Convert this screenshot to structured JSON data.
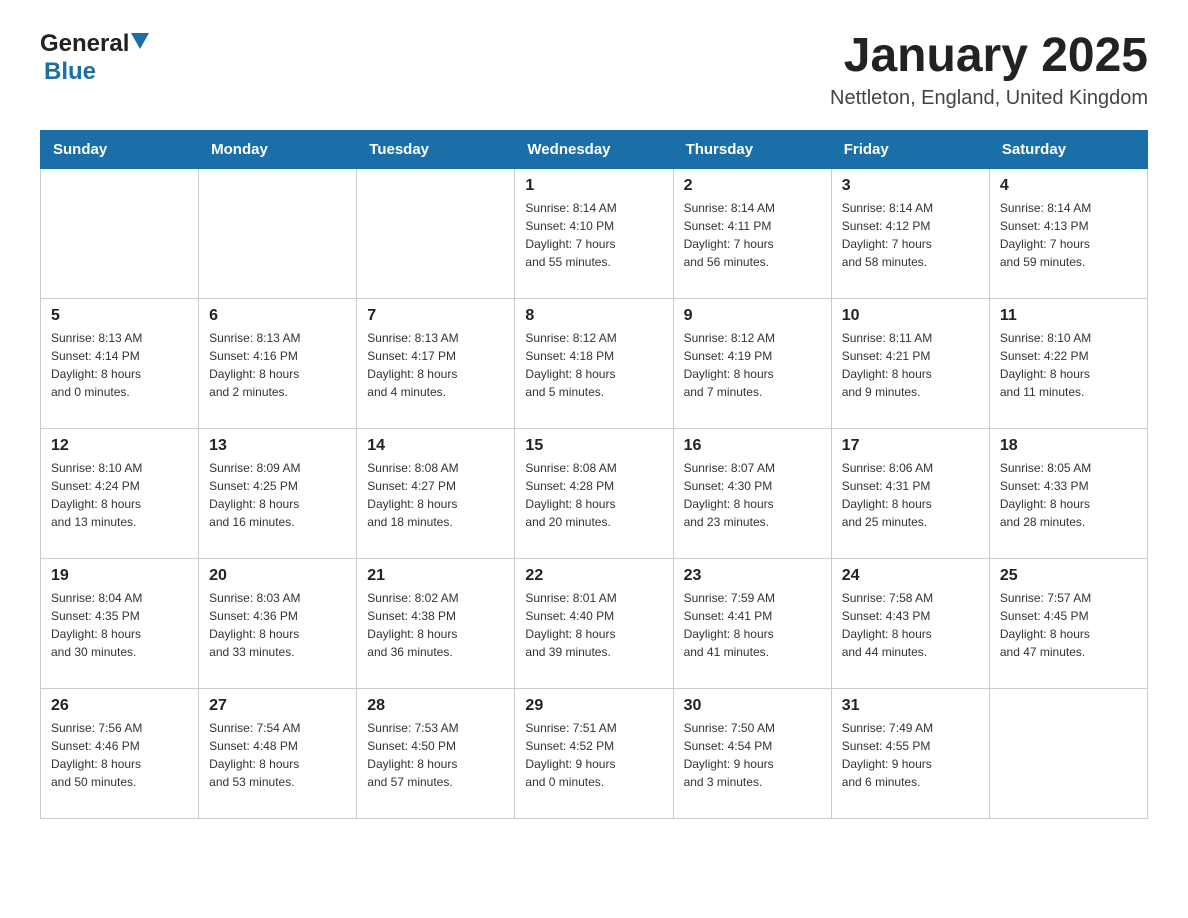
{
  "logo": {
    "text_general": "General",
    "text_blue": "Blue"
  },
  "header": {
    "title": "January 2025",
    "location": "Nettleton, England, United Kingdom"
  },
  "weekdays": [
    "Sunday",
    "Monday",
    "Tuesday",
    "Wednesday",
    "Thursday",
    "Friday",
    "Saturday"
  ],
  "weeks": [
    [
      {
        "day": "",
        "info": ""
      },
      {
        "day": "",
        "info": ""
      },
      {
        "day": "",
        "info": ""
      },
      {
        "day": "1",
        "info": "Sunrise: 8:14 AM\nSunset: 4:10 PM\nDaylight: 7 hours\nand 55 minutes."
      },
      {
        "day": "2",
        "info": "Sunrise: 8:14 AM\nSunset: 4:11 PM\nDaylight: 7 hours\nand 56 minutes."
      },
      {
        "day": "3",
        "info": "Sunrise: 8:14 AM\nSunset: 4:12 PM\nDaylight: 7 hours\nand 58 minutes."
      },
      {
        "day": "4",
        "info": "Sunrise: 8:14 AM\nSunset: 4:13 PM\nDaylight: 7 hours\nand 59 minutes."
      }
    ],
    [
      {
        "day": "5",
        "info": "Sunrise: 8:13 AM\nSunset: 4:14 PM\nDaylight: 8 hours\nand 0 minutes."
      },
      {
        "day": "6",
        "info": "Sunrise: 8:13 AM\nSunset: 4:16 PM\nDaylight: 8 hours\nand 2 minutes."
      },
      {
        "day": "7",
        "info": "Sunrise: 8:13 AM\nSunset: 4:17 PM\nDaylight: 8 hours\nand 4 minutes."
      },
      {
        "day": "8",
        "info": "Sunrise: 8:12 AM\nSunset: 4:18 PM\nDaylight: 8 hours\nand 5 minutes."
      },
      {
        "day": "9",
        "info": "Sunrise: 8:12 AM\nSunset: 4:19 PM\nDaylight: 8 hours\nand 7 minutes."
      },
      {
        "day": "10",
        "info": "Sunrise: 8:11 AM\nSunset: 4:21 PM\nDaylight: 8 hours\nand 9 minutes."
      },
      {
        "day": "11",
        "info": "Sunrise: 8:10 AM\nSunset: 4:22 PM\nDaylight: 8 hours\nand 11 minutes."
      }
    ],
    [
      {
        "day": "12",
        "info": "Sunrise: 8:10 AM\nSunset: 4:24 PM\nDaylight: 8 hours\nand 13 minutes."
      },
      {
        "day": "13",
        "info": "Sunrise: 8:09 AM\nSunset: 4:25 PM\nDaylight: 8 hours\nand 16 minutes."
      },
      {
        "day": "14",
        "info": "Sunrise: 8:08 AM\nSunset: 4:27 PM\nDaylight: 8 hours\nand 18 minutes."
      },
      {
        "day": "15",
        "info": "Sunrise: 8:08 AM\nSunset: 4:28 PM\nDaylight: 8 hours\nand 20 minutes."
      },
      {
        "day": "16",
        "info": "Sunrise: 8:07 AM\nSunset: 4:30 PM\nDaylight: 8 hours\nand 23 minutes."
      },
      {
        "day": "17",
        "info": "Sunrise: 8:06 AM\nSunset: 4:31 PM\nDaylight: 8 hours\nand 25 minutes."
      },
      {
        "day": "18",
        "info": "Sunrise: 8:05 AM\nSunset: 4:33 PM\nDaylight: 8 hours\nand 28 minutes."
      }
    ],
    [
      {
        "day": "19",
        "info": "Sunrise: 8:04 AM\nSunset: 4:35 PM\nDaylight: 8 hours\nand 30 minutes."
      },
      {
        "day": "20",
        "info": "Sunrise: 8:03 AM\nSunset: 4:36 PM\nDaylight: 8 hours\nand 33 minutes."
      },
      {
        "day": "21",
        "info": "Sunrise: 8:02 AM\nSunset: 4:38 PM\nDaylight: 8 hours\nand 36 minutes."
      },
      {
        "day": "22",
        "info": "Sunrise: 8:01 AM\nSunset: 4:40 PM\nDaylight: 8 hours\nand 39 minutes."
      },
      {
        "day": "23",
        "info": "Sunrise: 7:59 AM\nSunset: 4:41 PM\nDaylight: 8 hours\nand 41 minutes."
      },
      {
        "day": "24",
        "info": "Sunrise: 7:58 AM\nSunset: 4:43 PM\nDaylight: 8 hours\nand 44 minutes."
      },
      {
        "day": "25",
        "info": "Sunrise: 7:57 AM\nSunset: 4:45 PM\nDaylight: 8 hours\nand 47 minutes."
      }
    ],
    [
      {
        "day": "26",
        "info": "Sunrise: 7:56 AM\nSunset: 4:46 PM\nDaylight: 8 hours\nand 50 minutes."
      },
      {
        "day": "27",
        "info": "Sunrise: 7:54 AM\nSunset: 4:48 PM\nDaylight: 8 hours\nand 53 minutes."
      },
      {
        "day": "28",
        "info": "Sunrise: 7:53 AM\nSunset: 4:50 PM\nDaylight: 8 hours\nand 57 minutes."
      },
      {
        "day": "29",
        "info": "Sunrise: 7:51 AM\nSunset: 4:52 PM\nDaylight: 9 hours\nand 0 minutes."
      },
      {
        "day": "30",
        "info": "Sunrise: 7:50 AM\nSunset: 4:54 PM\nDaylight: 9 hours\nand 3 minutes."
      },
      {
        "day": "31",
        "info": "Sunrise: 7:49 AM\nSunset: 4:55 PM\nDaylight: 9 hours\nand 6 minutes."
      },
      {
        "day": "",
        "info": ""
      }
    ]
  ]
}
